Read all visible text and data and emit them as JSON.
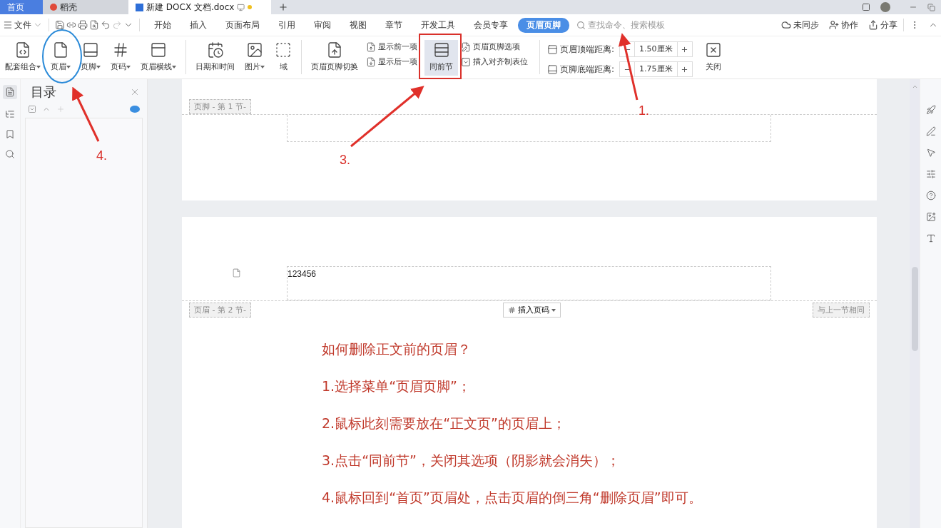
{
  "title_tabs": [
    {
      "label": "首页",
      "selected": false,
      "kind": "home"
    },
    {
      "label": "稻壳",
      "selected": false,
      "kind": "app"
    },
    {
      "label": "新建 DOCX 文档.docx",
      "selected": true,
      "kind": "doc"
    }
  ],
  "menu": {
    "file_label": "文件",
    "tabs": [
      {
        "label": "开始",
        "selected": false
      },
      {
        "label": "插入",
        "selected": false
      },
      {
        "label": "页面布局",
        "selected": false
      },
      {
        "label": "引用",
        "selected": false
      },
      {
        "label": "审阅",
        "selected": false
      },
      {
        "label": "视图",
        "selected": false
      },
      {
        "label": "章节",
        "selected": false
      },
      {
        "label": "开发工具",
        "selected": false
      },
      {
        "label": "会员专享",
        "selected": false
      },
      {
        "label": "页眉页脚",
        "selected": true
      }
    ],
    "search": {
      "placeholder": "查找命令、搜索模板"
    },
    "actions": [
      "未同步",
      "协作",
      "分享"
    ]
  },
  "ribbon": [
    {
      "kind": "large",
      "label": "配套组合",
      "dropdown": true,
      "selected": false
    },
    {
      "kind": "large",
      "label": "页眉",
      "dropdown": true,
      "selected": false
    },
    {
      "kind": "large",
      "label": "页脚",
      "dropdown": true,
      "selected": false
    },
    {
      "kind": "large",
      "label": "页码",
      "dropdown": true,
      "selected": false
    },
    {
      "kind": "large",
      "label": "页眉横线",
      "dropdown": true,
      "selected": false
    },
    {
      "kind": "separator"
    },
    {
      "kind": "large",
      "label": "日期和时间",
      "dropdown": false,
      "selected": false
    },
    {
      "kind": "large",
      "label": "图片",
      "dropdown": true,
      "selected": false
    },
    {
      "kind": "large",
      "label": "域",
      "dropdown": false,
      "selected": false
    },
    {
      "kind": "separator"
    },
    {
      "kind": "large",
      "label": "页眉页脚切换",
      "dropdown": false,
      "selected": false
    },
    {
      "kind": "stack",
      "items": [
        "显示前一项",
        "显示后一项"
      ]
    },
    {
      "kind": "large",
      "label": "同前节",
      "dropdown": false,
      "selected": true
    },
    {
      "kind": "stack",
      "items": [
        "页眉页脚选项",
        "插入对齐制表位"
      ]
    },
    {
      "kind": "separator"
    },
    {
      "kind": "spins",
      "items": [
        {
          "label": "页眉顶端距离:",
          "value": "1.50厘米"
        },
        {
          "label": "页脚底端距离:",
          "value": "1.75厘米"
        }
      ]
    },
    {
      "kind": "large",
      "label": "关闭",
      "dropdown": false,
      "selected": false
    }
  ],
  "toc": {
    "title": "目录"
  },
  "pages": [
    {
      "section_label": "页脚 - 第 1 节-"
    },
    {
      "header_text": "123456",
      "section_label": "页眉 - 第 2 节-",
      "insert_button": "插入页码",
      "same_label": "与上一节相同",
      "lines": [
        "如何删除正文前的页眉？",
        "1.选择菜单“页眉页脚”；",
        "2.鼠标此刻需要放在“正文页”的页眉上；",
        "3.点击“同前节”，关闭其选项（阴影就会消失）；",
        "4.鼠标回到“首页”页眉处，点击页眉的倒三角“删除页眉”即可。"
      ]
    }
  ],
  "annotations": [
    {
      "label": "1."
    },
    {
      "label": "3."
    },
    {
      "label": "4."
    }
  ]
}
